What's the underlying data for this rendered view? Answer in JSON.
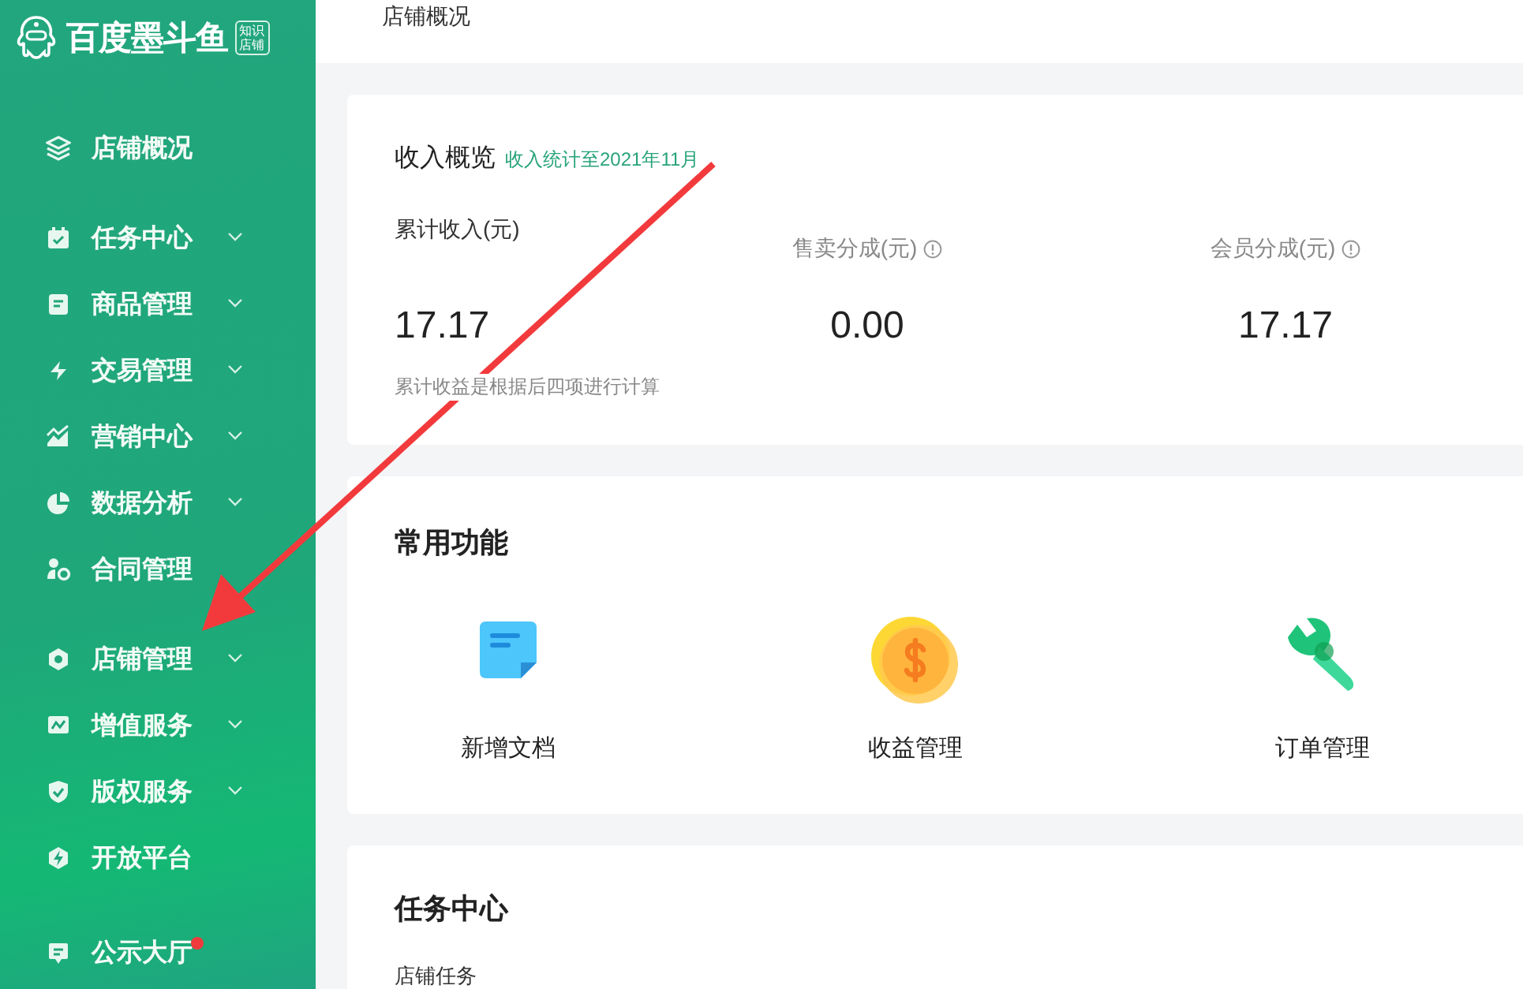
{
  "brand": {
    "name": "百度墨斗鱼",
    "tag_line_1": "知识",
    "tag_line_2": "店铺"
  },
  "sidebar": {
    "sections": [
      {
        "items": [
          {
            "label": "店铺概况",
            "expandable": false,
            "badge": false
          }
        ]
      },
      {
        "items": [
          {
            "label": "任务中心",
            "expandable": true,
            "badge": false
          },
          {
            "label": "商品管理",
            "expandable": true,
            "badge": false
          },
          {
            "label": "交易管理",
            "expandable": true,
            "badge": false
          },
          {
            "label": "营销中心",
            "expandable": true,
            "badge": false
          },
          {
            "label": "数据分析",
            "expandable": true,
            "badge": false
          },
          {
            "label": "合同管理",
            "expandable": false,
            "badge": false
          }
        ]
      },
      {
        "items": [
          {
            "label": "店铺管理",
            "expandable": true,
            "badge": false
          },
          {
            "label": "增值服务",
            "expandable": true,
            "badge": false
          },
          {
            "label": "版权服务",
            "expandable": true,
            "badge": false
          },
          {
            "label": "开放平台",
            "expandable": false,
            "badge": false
          }
        ]
      },
      {
        "items": [
          {
            "label": "公示大厅",
            "expandable": false,
            "badge": true
          }
        ]
      }
    ]
  },
  "header": {
    "title": "店铺概况"
  },
  "income": {
    "title": "收入概览",
    "subtitle": "收入统计至2021年11月",
    "stats": [
      {
        "label": "累计收入(元)",
        "value": "17.17",
        "info": false
      },
      {
        "label": "售卖分成(元)",
        "value": "0.00",
        "info": true
      },
      {
        "label": "会员分成(元)",
        "value": "17.17",
        "info": true
      }
    ],
    "note": "累计收益是根据后四项进行计算"
  },
  "functions": {
    "title": "常用功能",
    "items": [
      {
        "label": "新增文档",
        "kind": "document"
      },
      {
        "label": "收益管理",
        "kind": "coin"
      },
      {
        "label": "订单管理",
        "kind": "wrench"
      }
    ]
  },
  "tasks": {
    "title": "任务中心",
    "subtitle": "店铺任务"
  },
  "annotation": {
    "kind": "arrow"
  }
}
